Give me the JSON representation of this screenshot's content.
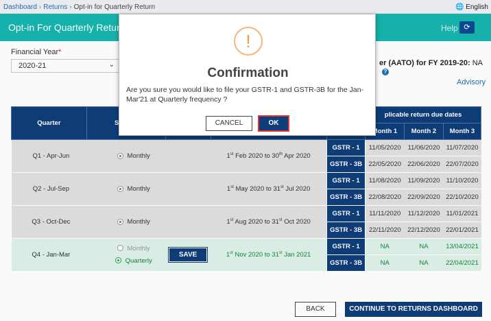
{
  "breadcrumb": {
    "items": [
      "Dashboard",
      "Returns",
      "Opt-in for Quarterly Return"
    ]
  },
  "language": "English",
  "header": {
    "title": "Opt-in For Quarterly Return",
    "help": "Help"
  },
  "filter": {
    "label": "Financial Year",
    "required_mark": "*",
    "value": "2020-21"
  },
  "aato": {
    "label": "er (AATO) for FY 2019-20:",
    "value": "NA"
  },
  "advisory": "Advisory",
  "table": {
    "headers": {
      "quarter": "Quarter",
      "select": "Selecte",
      "due": "plicable return due dates",
      "m1": "Month 1",
      "m2": "Month 2",
      "m3": "Month 3"
    },
    "rows": [
      {
        "quarter": "Q1 - Apr-Jun",
        "freq": "Monthly",
        "period": {
          "a": "1",
          "b": "Feb 2020 to 30",
          "c": "Apr 2020"
        },
        "gstr1": {
          "name": "GSTR - 1",
          "m1": "11/05/2020",
          "m2": "11/06/2020",
          "m3": "11/07/2020"
        },
        "gstr3b": {
          "name": "GSTR - 3B",
          "m1": "22/05/2020",
          "m2": "22/06/2020",
          "m3": "22/07/2020"
        }
      },
      {
        "quarter": "Q2 - Jul-Sep",
        "freq": "Monthly",
        "period": {
          "a": "1",
          "b": "May 2020 to 31",
          "c": "Jul 2020"
        },
        "gstr1": {
          "name": "GSTR - 1",
          "m1": "11/08/2020",
          "m2": "11/09/2020",
          "m3": "11/10/2020"
        },
        "gstr3b": {
          "name": "GSTR - 3B",
          "m1": "22/08/2020",
          "m2": "22/09/2020",
          "m3": "22/10/2020"
        }
      },
      {
        "quarter": "Q3 - Oct-Dec",
        "freq": "Monthly",
        "period": {
          "a": "1",
          "b": "Aug 2020 to 31",
          "c": "Oct 2020"
        },
        "gstr1": {
          "name": "GSTR - 1",
          "m1": "11/11/2020",
          "m2": "11/12/2020",
          "m3": "11/01/2021"
        },
        "gstr3b": {
          "name": "GSTR - 3B",
          "m1": "22/11/2020",
          "m2": "22/12/2020",
          "m3": "22/01/2021"
        }
      },
      {
        "quarter": "Q4 - Jan-Mar",
        "freq_monthly": "Monthly",
        "freq_quarterly": "Quarterly",
        "save": "SAVE",
        "period": {
          "a": "1",
          "b": "Nov 2020 to 31",
          "c": "Jan 2021"
        },
        "gstr1": {
          "name": "GSTR - 1",
          "m1": "NA",
          "m2": "NA",
          "m3": "13/04/2021"
        },
        "gstr3b": {
          "name": "GSTR - 3B",
          "m1": "NA",
          "m2": "NA",
          "m3": "22/04/2021"
        }
      }
    ],
    "superscripts": {
      "st": "st",
      "th": "th"
    }
  },
  "footer": {
    "back": "BACK",
    "continue": "CONTINUE TO RETURNS DASHBOARD"
  },
  "modal": {
    "title": "Confirmation",
    "message": "Are you sure you would like to file your GSTR-1 and GSTR-3B for the Jan-Mar'21 at Quarterly frequency ?",
    "cancel": "CANCEL",
    "ok": "OK"
  },
  "colors": {
    "header_teal": "#17b5ae",
    "navy": "#0e3e7a",
    "ok_outline": "#e43333",
    "warning": "#f19a4c"
  }
}
